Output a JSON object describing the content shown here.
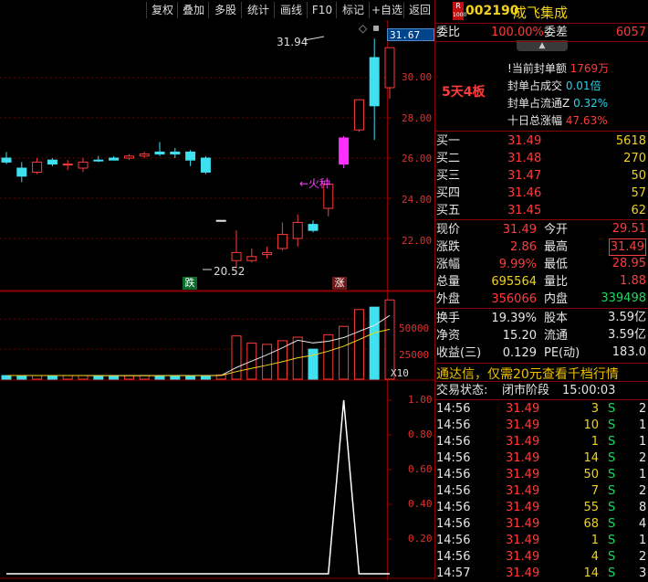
{
  "toolbar": {
    "buttons": [
      "复权",
      "叠加",
      "多股",
      "统计",
      "画线",
      "F10",
      "标记",
      "+自选",
      "返回"
    ]
  },
  "stock": {
    "badge_top": "R",
    "badge_bottom": "1000",
    "code": "002190",
    "name": "成飞集成"
  },
  "order_ratio": {
    "label": "委比",
    "value": "100.00%",
    "diff_label": "委差",
    "diff_value": "6057"
  },
  "seal": {
    "streak": "5天4板",
    "lines": [
      {
        "label": "当前封单额",
        "value": "1769万"
      },
      {
        "label": "封单占成交",
        "value": "0.01倍"
      },
      {
        "label": "封单占流通Z",
        "value": "0.32%"
      },
      {
        "label": "十日总涨幅",
        "value": "47.63%"
      }
    ]
  },
  "bids": [
    {
      "label": "买一",
      "price": "31.49",
      "vol": "5618"
    },
    {
      "label": "买二",
      "price": "31.48",
      "vol": "270"
    },
    {
      "label": "买三",
      "price": "31.47",
      "vol": "50"
    },
    {
      "label": "买四",
      "price": "31.46",
      "vol": "57"
    },
    {
      "label": "买五",
      "price": "31.45",
      "vol": "62"
    }
  ],
  "quote": [
    {
      "l1": "现价",
      "v1": "31.49",
      "l2": "今开",
      "v2": "29.51"
    },
    {
      "l1": "涨跌",
      "v1": "2.86",
      "l2": "最高",
      "v2": "31.49"
    },
    {
      "l1": "涨幅",
      "v1": "9.99%",
      "l2": "最低",
      "v2": "28.95"
    },
    {
      "l1": "总量",
      "v1": "695564",
      "l2": "量比",
      "v2": "1.88"
    },
    {
      "l1": "外盘",
      "v1": "356066",
      "l2": "内盘",
      "v2": "339498"
    },
    {
      "l1": "换手",
      "v1": "19.39%",
      "l2": "股本",
      "v2": "3.59亿"
    },
    {
      "l1": "净资",
      "v1": "15.20",
      "l2": "流通",
      "v2": "3.59亿"
    },
    {
      "l1": "收益(三)",
      "v1": "0.129",
      "l2": "PE(动)",
      "v2": "183.0"
    }
  ],
  "ad_banner": "通达信，仅需20元查看千档行情",
  "trade_status": {
    "label": "交易状态:",
    "value": "闭市阶段",
    "time": "15:00:03"
  },
  "ticks": [
    {
      "time": "14:56",
      "price": "31.49",
      "vol": "3",
      "side": "S",
      "n": "2"
    },
    {
      "time": "14:56",
      "price": "31.49",
      "vol": "10",
      "side": "S",
      "n": "1"
    },
    {
      "time": "14:56",
      "price": "31.49",
      "vol": "1",
      "side": "S",
      "n": "1"
    },
    {
      "time": "14:56",
      "price": "31.49",
      "vol": "14",
      "side": "S",
      "n": "2"
    },
    {
      "time": "14:56",
      "price": "31.49",
      "vol": "50",
      "side": "S",
      "n": "1"
    },
    {
      "time": "14:56",
      "price": "31.49",
      "vol": "7",
      "side": "S",
      "n": "2"
    },
    {
      "time": "14:56",
      "price": "31.49",
      "vol": "55",
      "side": "S",
      "n": "8"
    },
    {
      "time": "14:56",
      "price": "31.49",
      "vol": "68",
      "side": "S",
      "n": "4"
    },
    {
      "time": "14:56",
      "price": "31.49",
      "vol": "1",
      "side": "S",
      "n": "1"
    },
    {
      "time": "14:56",
      "price": "31.49",
      "vol": "4",
      "side": "S",
      "n": "2"
    },
    {
      "time": "14:57",
      "price": "31.49",
      "vol": "14",
      "side": "S",
      "n": "3"
    }
  ],
  "price_axis": {
    "current": "31.67",
    "ticks": [
      "30.00",
      "28.00",
      "26.00",
      "24.00",
      "22.00"
    ]
  },
  "volume_axis": {
    "ticks": [
      "50000",
      "25000"
    ],
    "multiplier": "X10"
  },
  "indicator_axis": {
    "ticks": [
      "1.00",
      "0.80",
      "0.60",
      "0.40",
      "0.20"
    ]
  },
  "annotations": {
    "high": "31.94",
    "low": "20.52",
    "fire": "←火种",
    "down_tag": "跌",
    "up_tag": "涨"
  },
  "chart_data": [
    {
      "type": "candlestick",
      "ylim": [
        19.5,
        32.5
      ],
      "candles": [
        {
          "o": 26.0,
          "h": 26.3,
          "l": 25.7,
          "c": 25.8,
          "color": "cyan"
        },
        {
          "o": 25.5,
          "h": 25.8,
          "l": 24.8,
          "c": 25.1,
          "color": "cyan"
        },
        {
          "o": 25.3,
          "h": 26.0,
          "l": 25.2,
          "c": 25.8,
          "color": "red"
        },
        {
          "o": 25.9,
          "h": 26.0,
          "l": 25.6,
          "c": 25.7,
          "color": "cyan"
        },
        {
          "o": 25.7,
          "h": 25.9,
          "l": 25.4,
          "c": 25.7,
          "color": "red"
        },
        {
          "o": 25.5,
          "h": 26.0,
          "l": 25.3,
          "c": 25.8,
          "color": "red"
        },
        {
          "o": 25.9,
          "h": 26.1,
          "l": 25.8,
          "c": 25.9,
          "color": "cyan"
        },
        {
          "o": 26.0,
          "h": 26.1,
          "l": 25.9,
          "c": 25.9,
          "color": "cyan"
        },
        {
          "o": 26.0,
          "h": 26.2,
          "l": 25.9,
          "c": 26.1,
          "color": "red"
        },
        {
          "o": 26.1,
          "h": 26.3,
          "l": 26.0,
          "c": 26.2,
          "color": "red"
        },
        {
          "o": 26.2,
          "h": 26.8,
          "l": 26.1,
          "c": 26.3,
          "color": "cyan"
        },
        {
          "o": 26.3,
          "h": 26.5,
          "l": 26.0,
          "c": 26.2,
          "color": "cyan"
        },
        {
          "o": 26.3,
          "h": 26.4,
          "l": 25.6,
          "c": 25.9,
          "color": "cyan"
        },
        {
          "o": 26.0,
          "h": 26.1,
          "l": 25.2,
          "c": 25.3,
          "color": "cyan"
        },
        {
          "o": 22.9,
          "h": 22.9,
          "l": 22.9,
          "c": 22.9,
          "color": "white"
        },
        {
          "o": 21.3,
          "h": 22.4,
          "l": 20.5,
          "c": 20.9,
          "color": "red"
        },
        {
          "o": 20.9,
          "h": 21.5,
          "l": 20.8,
          "c": 21.1,
          "color": "red"
        },
        {
          "o": 21.2,
          "h": 21.6,
          "l": 21.0,
          "c": 21.3,
          "color": "red"
        },
        {
          "o": 21.5,
          "h": 22.8,
          "l": 21.4,
          "c": 22.2,
          "color": "red"
        },
        {
          "o": 22.0,
          "h": 23.2,
          "l": 21.6,
          "c": 22.8,
          "color": "red"
        },
        {
          "o": 22.7,
          "h": 22.9,
          "l": 22.3,
          "c": 22.4,
          "color": "cyan"
        },
        {
          "o": 23.5,
          "h": 24.7,
          "l": 23.1,
          "c": 24.7,
          "color": "red"
        },
        {
          "o": 27.0,
          "h": 27.1,
          "l": 25.5,
          "c": 25.7,
          "color": "magenta"
        },
        {
          "o": 27.4,
          "h": 28.9,
          "l": 27.3,
          "c": 28.9,
          "color": "red"
        },
        {
          "o": 31.0,
          "h": 31.94,
          "l": 26.9,
          "c": 28.6,
          "color": "cyan"
        },
        {
          "o": 29.5,
          "h": 31.49,
          "l": 28.95,
          "c": 31.49,
          "color": "red"
        }
      ]
    },
    {
      "type": "bar",
      "ylim": [
        0,
        70000
      ],
      "values": [
        3000,
        3000,
        3000,
        3000,
        3000,
        3000,
        2800,
        3000,
        3000,
        3000,
        3000,
        3000,
        3000,
        3000,
        3500,
        36000,
        30000,
        29000,
        32000,
        35000,
        25000,
        37000,
        44000,
        58000,
        60000,
        66000
      ],
      "colors": [
        "cyan",
        "cyan",
        "red",
        "cyan",
        "red",
        "red",
        "cyan",
        "cyan",
        "red",
        "red",
        "cyan",
        "cyan",
        "cyan",
        "cyan",
        "red",
        "red",
        "red",
        "red",
        "red",
        "red",
        "cyan",
        "red",
        "red",
        "red",
        "cyan",
        "red"
      ]
    },
    {
      "type": "line",
      "ylim": [
        0,
        1.1
      ],
      "values": [
        0,
        0,
        0,
        0,
        0,
        0,
        0,
        0,
        0,
        0,
        0,
        0,
        0,
        0,
        0,
        0,
        0,
        0,
        0,
        0,
        0,
        0,
        1.0,
        0,
        0,
        0
      ]
    }
  ]
}
